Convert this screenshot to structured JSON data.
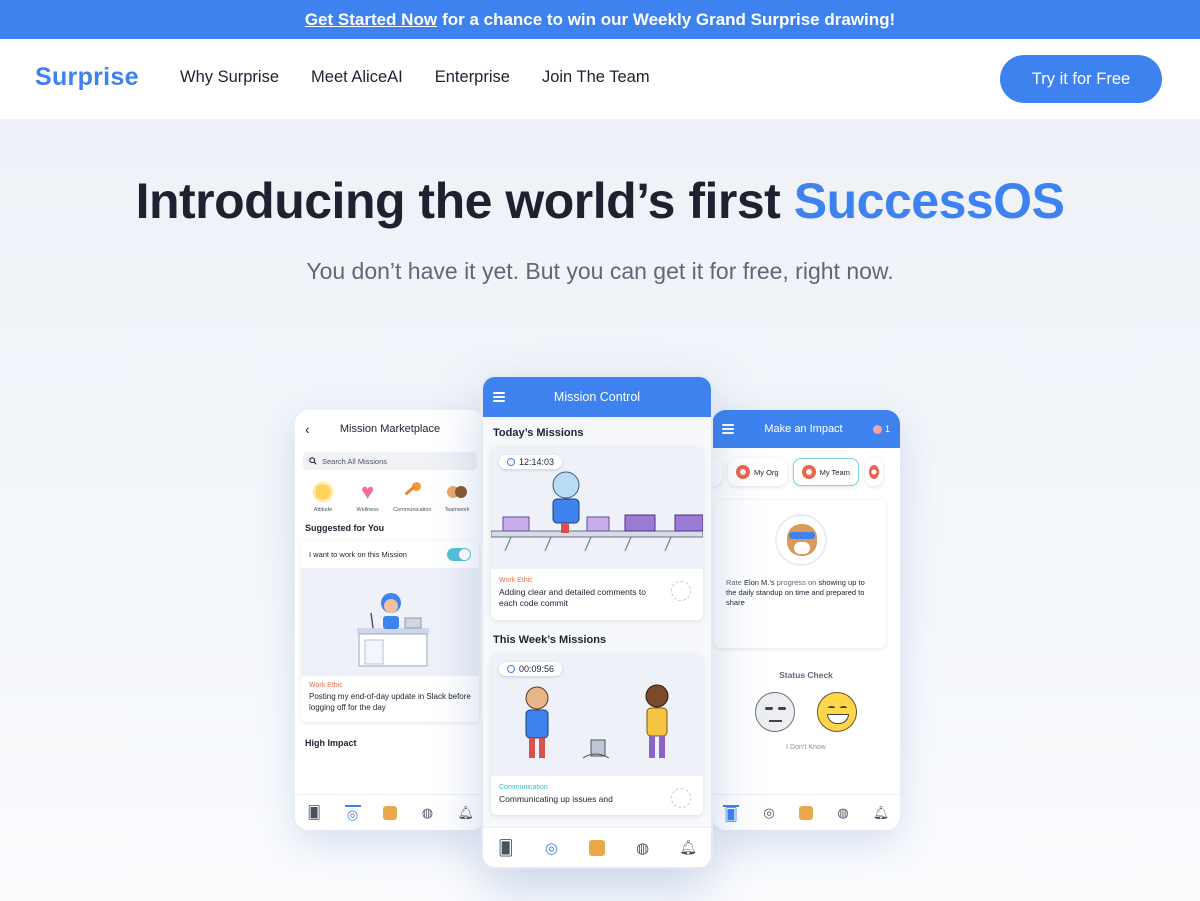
{
  "banner": {
    "link": "Get Started Now",
    "text": "for a chance to win our Weekly Grand Surprise drawing!"
  },
  "header": {
    "logo": "Surprise",
    "nav": [
      "Why Surprise",
      "Meet AliceAI",
      "Enterprise",
      "Join The Team"
    ],
    "cta": "Try it for Free"
  },
  "hero": {
    "title_main": "Introducing the world’s first",
    "title_accent": "SuccessOS",
    "subtitle": "You don’t have it yet. But you can get it for free, right now."
  },
  "phone_left": {
    "title": "Mission Marketplace",
    "search_placeholder": "Search All Missions",
    "categories": [
      "Attitude",
      "Wellness",
      "Communication",
      "Teamwork"
    ],
    "suggested_label": "Suggested for You",
    "toggle_label": "I want to work on this Mission",
    "card_tag": "Work Ethic",
    "card_text": "Posting my end-of-day update in Slack before logging off for the day",
    "high_impact_label": "High Impact"
  },
  "phone_center": {
    "title": "Mission Control",
    "today_label": "Today’s Missions",
    "today_timer": "12:14:03",
    "today_tag": "Work Ethic",
    "today_text": "Adding clear and detailed comments to each code commit",
    "week_label": "This Week’s Missions",
    "week_timer": "00:09:56",
    "week_tag": "Communication",
    "week_text": "Communicating up issues and"
  },
  "phone_right": {
    "title": "Make an Impact",
    "badge_count": "1",
    "chips": [
      "My Org",
      "My Team"
    ],
    "rate_prefix": "Rate",
    "rate_name": "Elon M.’s",
    "rate_mid": "progress on",
    "rate_text": "showing up to the daily standup on time and prepared to share",
    "status_label": "Status Check",
    "status_option": "I Don’t Know"
  },
  "colors": {
    "brand": "#3d82ee",
    "text": "#1c2230",
    "muted": "#5f6877",
    "tag_orange": "#e86c4e",
    "tag_teal": "#3fb6c9"
  },
  "icons": {
    "tabbar": [
      "cards-icon",
      "fingerprint-icon",
      "mascot-icon",
      "globe-icon",
      "bell-icon"
    ]
  }
}
